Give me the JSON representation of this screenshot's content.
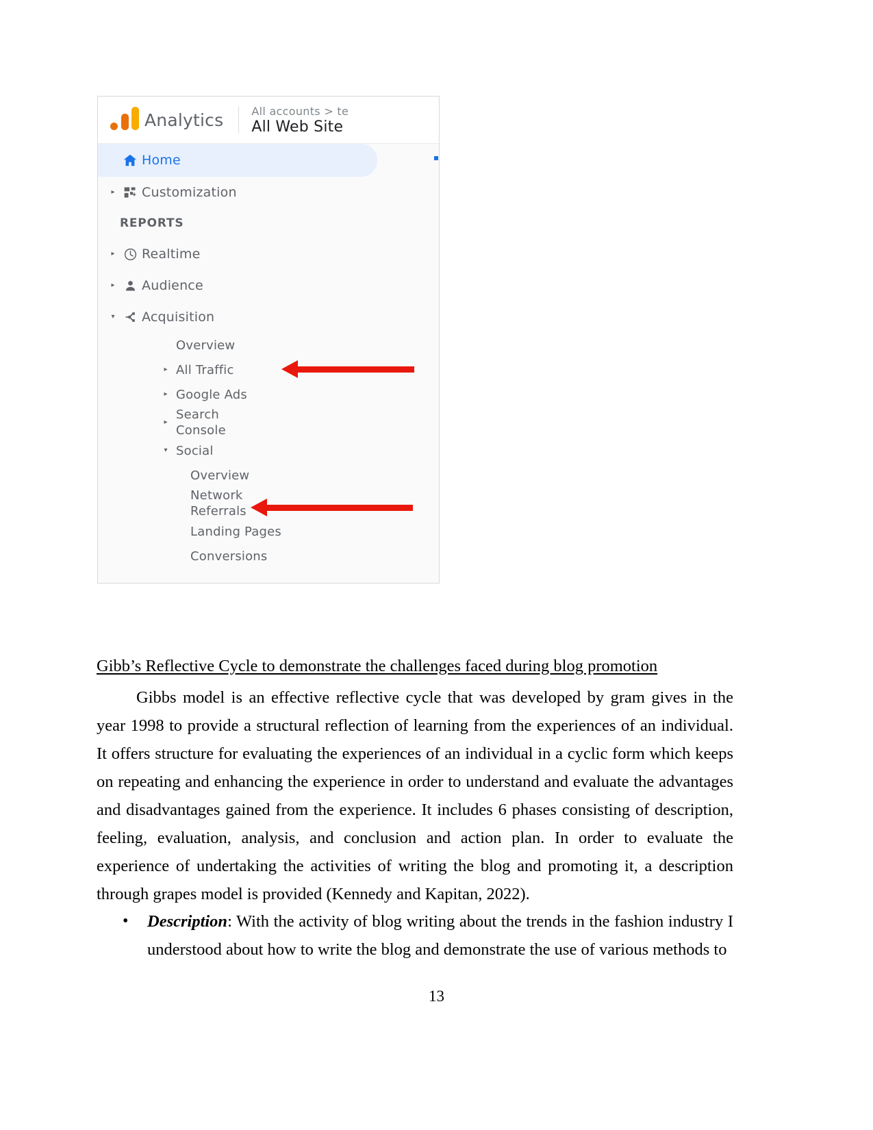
{
  "document": {
    "page_number": "13",
    "heading": "Gibb’s Reflective Cycle to demonstrate the challenges faced during blog promotion",
    "paragraph": "Gibbs model is an effective reflective cycle that was developed by gram gives in the year 1998 to provide a structural reflection of learning from the experiences of an individual. It offers structure for evaluating the experiences of an individual in a cyclic form which keeps on repeating and enhancing the experience in order to understand and evaluate the advantages and disadvantages gained from the experience. It includes 6 phases consisting of description, feeling, evaluation, analysis, and conclusion and action plan. In order to evaluate the experience of undertaking the activities of writing the blog and promoting it, a description through grapes model is provided (Kennedy and Kapitan, 2022).",
    "bullets": [
      {
        "bullet_glyph": "•",
        "term": "Description",
        "text": ": With the activity of blog writing about the trends in the fashion industry I understood about how to write the blog and demonstrate the use of various methods to"
      }
    ]
  },
  "screenshot": {
    "app_title": "Analytics",
    "account_breadcrumb": "All accounts > te",
    "property_name": "All Web Site",
    "nav": {
      "home_label": "Home",
      "customization_label": "Customization",
      "reports_section_label": "REPORTS",
      "realtime_label": "Realtime",
      "audience_label": "Audience",
      "acquisition_label": "Acquisition",
      "acquisition_children": [
        "Overview",
        "All Traffic",
        "Google Ads",
        "Search Console"
      ],
      "social_label": "Social",
      "social_children": [
        "Overview",
        "Network Referrals",
        "Landing Pages",
        "Conversions"
      ]
    },
    "colors": {
      "annotation_arrow": "#e8180c",
      "active_item": "#1a73e8",
      "active_background": "#e8f0fe",
      "logo_orange": "#e8710a",
      "logo_yellow": "#f9ab00"
    }
  }
}
